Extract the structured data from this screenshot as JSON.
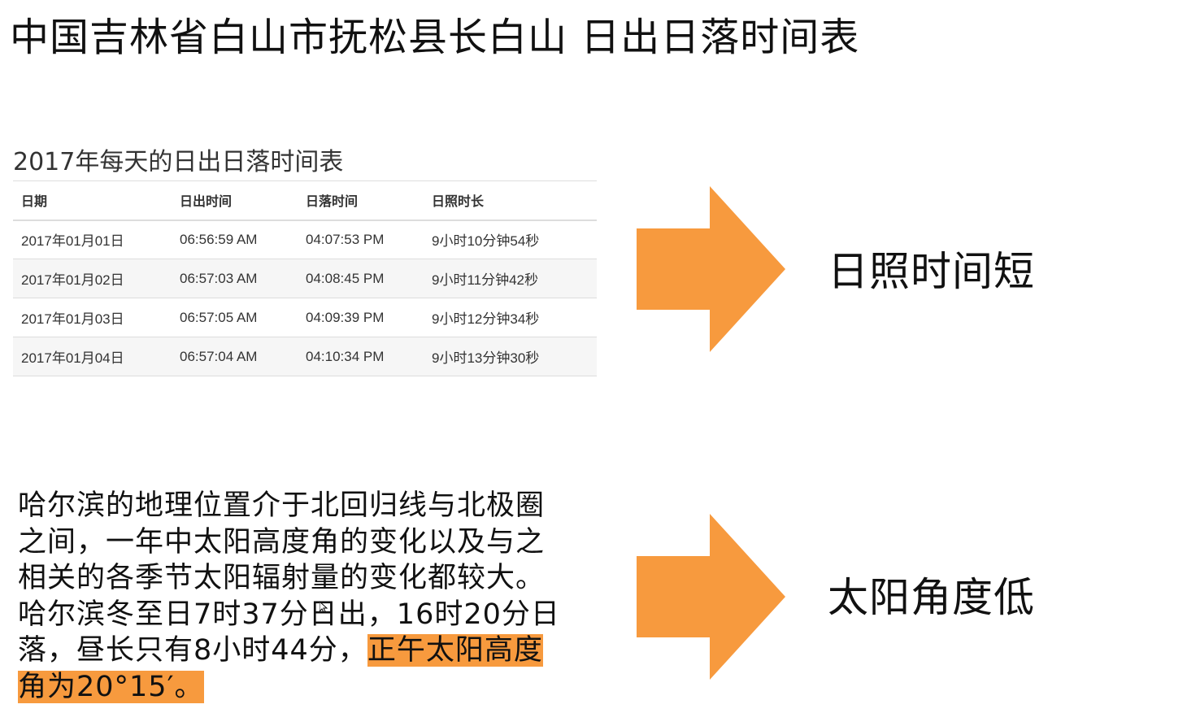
{
  "page": {
    "title": "中国吉林省白山市抚松县长白山  日出日落时间表"
  },
  "table": {
    "caption": "2017年每天的日出日落时间表",
    "columns": [
      "日期",
      "日出时间",
      "日落时间",
      "日照时长"
    ],
    "rows": [
      [
        "2017年01月01日",
        "06:56:59 AM",
        "04:07:53 PM",
        "9小时10分钟54秒"
      ],
      [
        "2017年01月02日",
        "06:57:03 AM",
        "04:08:45 PM",
        "9小时11分钟42秒"
      ],
      [
        "2017年01月03日",
        "06:57:05 AM",
        "04:09:39 PM",
        "9小时12分钟34秒"
      ],
      [
        "2017年01月04日",
        "06:57:04 AM",
        "04:10:34 PM",
        "9小时13分钟30秒"
      ]
    ]
  },
  "arrows": {
    "top_label": "日照时间短",
    "bottom_label": "太阳角度低",
    "color": "#f79a3e"
  },
  "paragraph": {
    "text_plain": "哈尔滨的地理位置介于北回归线与北极圈之间，一年中太阳高度角的变化以及与之相关的各季节太阳辐射量的变化都较大。哈尔滨冬至日7时37分日出，16时20分日落，昼长只有8小时44分，",
    "text_highlight": "正午太阳高度角为20°15′。",
    "highlight_color": "#f79a3e"
  }
}
